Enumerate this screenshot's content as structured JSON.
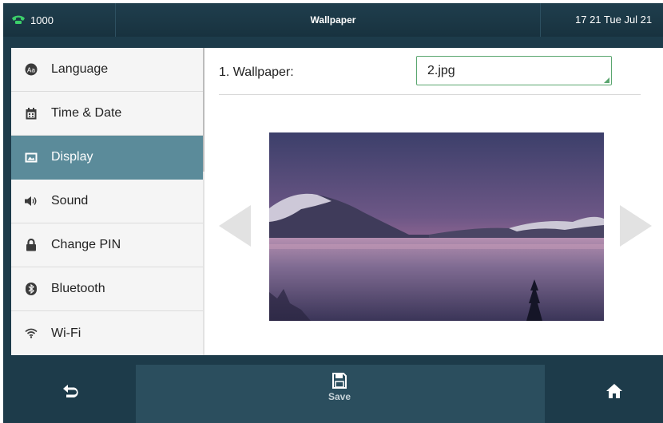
{
  "status_bar": {
    "line": "1000",
    "title": "Wallpaper",
    "datetime": "17 21 Tue Jul 21",
    "phone_icon": "phone-handset-icon",
    "accent_color": "#3ccf6a"
  },
  "sidebar": {
    "items": [
      {
        "label": "Language",
        "icon": "language-icon",
        "active": false
      },
      {
        "label": "Time & Date",
        "icon": "calendar-icon",
        "active": false
      },
      {
        "label": "Display",
        "icon": "display-icon",
        "active": true
      },
      {
        "label": "Sound",
        "icon": "speaker-icon",
        "active": false
      },
      {
        "label": "Change PIN",
        "icon": "lock-icon",
        "active": false
      },
      {
        "label": "Bluetooth",
        "icon": "bluetooth-icon",
        "active": false
      },
      {
        "label": "Wi-Fi",
        "icon": "wifi-icon",
        "active": false
      }
    ],
    "active_color": "#5b8b9a"
  },
  "main": {
    "wallpaper_label": "1. Wallpaper:",
    "wallpaper_value": "2.jpg"
  },
  "softkeys": {
    "back_icon": "back-arrow-icon",
    "save_label": "Save",
    "save_icon": "save-icon",
    "home_icon": "home-icon"
  }
}
